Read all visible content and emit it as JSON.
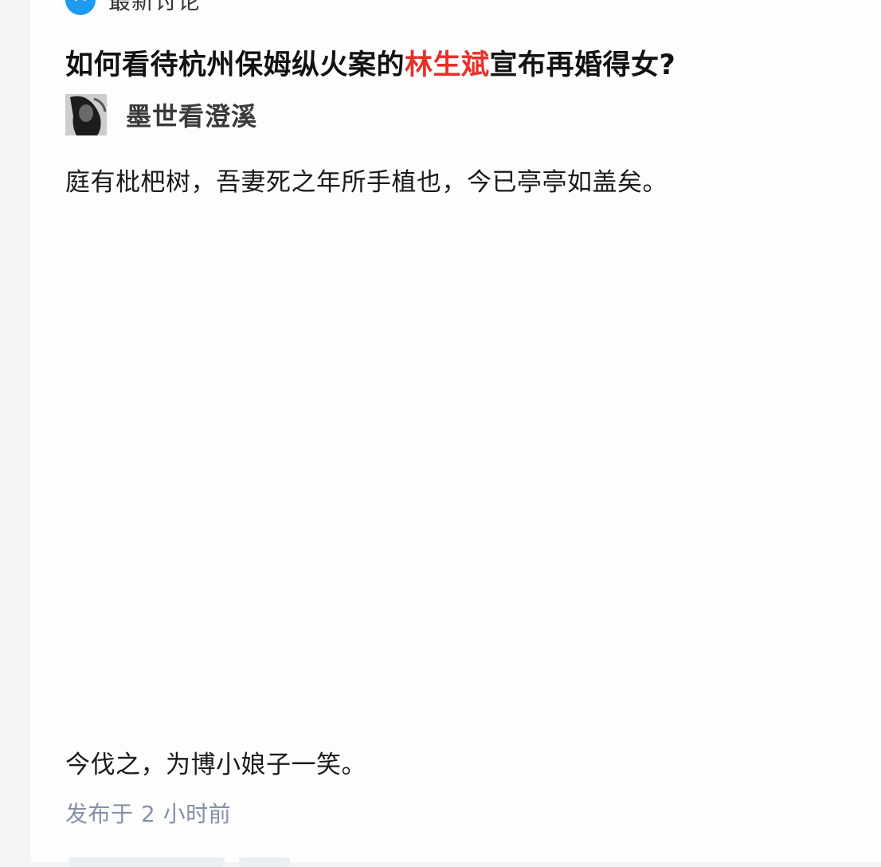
{
  "header": {
    "icon": "speech-bubble-icon",
    "label": "最新讨论",
    "accent_color": "#1e9bf0"
  },
  "question": {
    "title_before": "如何看待杭州保姆纵火案的",
    "title_highlight": "林生斌",
    "title_after": "宣布再婚得女?",
    "highlight_color": "#e8302a"
  },
  "author": {
    "name": "墨世看澄溪"
  },
  "answer": {
    "paragraph_1": "庭有枇杷树，吾妻死之年所手植也，今已亭亭如盖矣。",
    "paragraph_2": "今伐之，为博小娘子一笑。"
  },
  "meta": {
    "published": "发布于 2 小时前"
  }
}
